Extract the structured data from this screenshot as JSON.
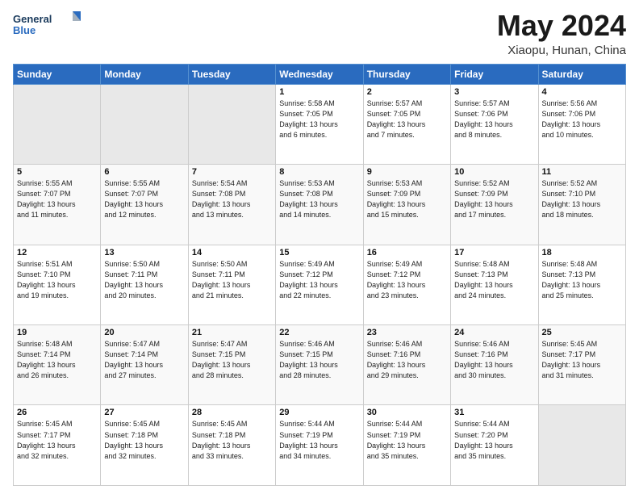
{
  "header": {
    "logo_line1": "General",
    "logo_line2": "Blue",
    "month": "May 2024",
    "location": "Xiaopu, Hunan, China"
  },
  "days_of_week": [
    "Sunday",
    "Monday",
    "Tuesday",
    "Wednesday",
    "Thursday",
    "Friday",
    "Saturday"
  ],
  "weeks": [
    [
      {
        "day": "",
        "info": ""
      },
      {
        "day": "",
        "info": ""
      },
      {
        "day": "",
        "info": ""
      },
      {
        "day": "1",
        "info": "Sunrise: 5:58 AM\nSunset: 7:05 PM\nDaylight: 13 hours\nand 6 minutes."
      },
      {
        "day": "2",
        "info": "Sunrise: 5:57 AM\nSunset: 7:05 PM\nDaylight: 13 hours\nand 7 minutes."
      },
      {
        "day": "3",
        "info": "Sunrise: 5:57 AM\nSunset: 7:06 PM\nDaylight: 13 hours\nand 8 minutes."
      },
      {
        "day": "4",
        "info": "Sunrise: 5:56 AM\nSunset: 7:06 PM\nDaylight: 13 hours\nand 10 minutes."
      }
    ],
    [
      {
        "day": "5",
        "info": "Sunrise: 5:55 AM\nSunset: 7:07 PM\nDaylight: 13 hours\nand 11 minutes."
      },
      {
        "day": "6",
        "info": "Sunrise: 5:55 AM\nSunset: 7:07 PM\nDaylight: 13 hours\nand 12 minutes."
      },
      {
        "day": "7",
        "info": "Sunrise: 5:54 AM\nSunset: 7:08 PM\nDaylight: 13 hours\nand 13 minutes."
      },
      {
        "day": "8",
        "info": "Sunrise: 5:53 AM\nSunset: 7:08 PM\nDaylight: 13 hours\nand 14 minutes."
      },
      {
        "day": "9",
        "info": "Sunrise: 5:53 AM\nSunset: 7:09 PM\nDaylight: 13 hours\nand 15 minutes."
      },
      {
        "day": "10",
        "info": "Sunrise: 5:52 AM\nSunset: 7:09 PM\nDaylight: 13 hours\nand 17 minutes."
      },
      {
        "day": "11",
        "info": "Sunrise: 5:52 AM\nSunset: 7:10 PM\nDaylight: 13 hours\nand 18 minutes."
      }
    ],
    [
      {
        "day": "12",
        "info": "Sunrise: 5:51 AM\nSunset: 7:10 PM\nDaylight: 13 hours\nand 19 minutes."
      },
      {
        "day": "13",
        "info": "Sunrise: 5:50 AM\nSunset: 7:11 PM\nDaylight: 13 hours\nand 20 minutes."
      },
      {
        "day": "14",
        "info": "Sunrise: 5:50 AM\nSunset: 7:11 PM\nDaylight: 13 hours\nand 21 minutes."
      },
      {
        "day": "15",
        "info": "Sunrise: 5:49 AM\nSunset: 7:12 PM\nDaylight: 13 hours\nand 22 minutes."
      },
      {
        "day": "16",
        "info": "Sunrise: 5:49 AM\nSunset: 7:12 PM\nDaylight: 13 hours\nand 23 minutes."
      },
      {
        "day": "17",
        "info": "Sunrise: 5:48 AM\nSunset: 7:13 PM\nDaylight: 13 hours\nand 24 minutes."
      },
      {
        "day": "18",
        "info": "Sunrise: 5:48 AM\nSunset: 7:13 PM\nDaylight: 13 hours\nand 25 minutes."
      }
    ],
    [
      {
        "day": "19",
        "info": "Sunrise: 5:48 AM\nSunset: 7:14 PM\nDaylight: 13 hours\nand 26 minutes."
      },
      {
        "day": "20",
        "info": "Sunrise: 5:47 AM\nSunset: 7:14 PM\nDaylight: 13 hours\nand 27 minutes."
      },
      {
        "day": "21",
        "info": "Sunrise: 5:47 AM\nSunset: 7:15 PM\nDaylight: 13 hours\nand 28 minutes."
      },
      {
        "day": "22",
        "info": "Sunrise: 5:46 AM\nSunset: 7:15 PM\nDaylight: 13 hours\nand 28 minutes."
      },
      {
        "day": "23",
        "info": "Sunrise: 5:46 AM\nSunset: 7:16 PM\nDaylight: 13 hours\nand 29 minutes."
      },
      {
        "day": "24",
        "info": "Sunrise: 5:46 AM\nSunset: 7:16 PM\nDaylight: 13 hours\nand 30 minutes."
      },
      {
        "day": "25",
        "info": "Sunrise: 5:45 AM\nSunset: 7:17 PM\nDaylight: 13 hours\nand 31 minutes."
      }
    ],
    [
      {
        "day": "26",
        "info": "Sunrise: 5:45 AM\nSunset: 7:17 PM\nDaylight: 13 hours\nand 32 minutes."
      },
      {
        "day": "27",
        "info": "Sunrise: 5:45 AM\nSunset: 7:18 PM\nDaylight: 13 hours\nand 32 minutes."
      },
      {
        "day": "28",
        "info": "Sunrise: 5:45 AM\nSunset: 7:18 PM\nDaylight: 13 hours\nand 33 minutes."
      },
      {
        "day": "29",
        "info": "Sunrise: 5:44 AM\nSunset: 7:19 PM\nDaylight: 13 hours\nand 34 minutes."
      },
      {
        "day": "30",
        "info": "Sunrise: 5:44 AM\nSunset: 7:19 PM\nDaylight: 13 hours\nand 35 minutes."
      },
      {
        "day": "31",
        "info": "Sunrise: 5:44 AM\nSunset: 7:20 PM\nDaylight: 13 hours\nand 35 minutes."
      },
      {
        "day": "",
        "info": ""
      }
    ]
  ]
}
